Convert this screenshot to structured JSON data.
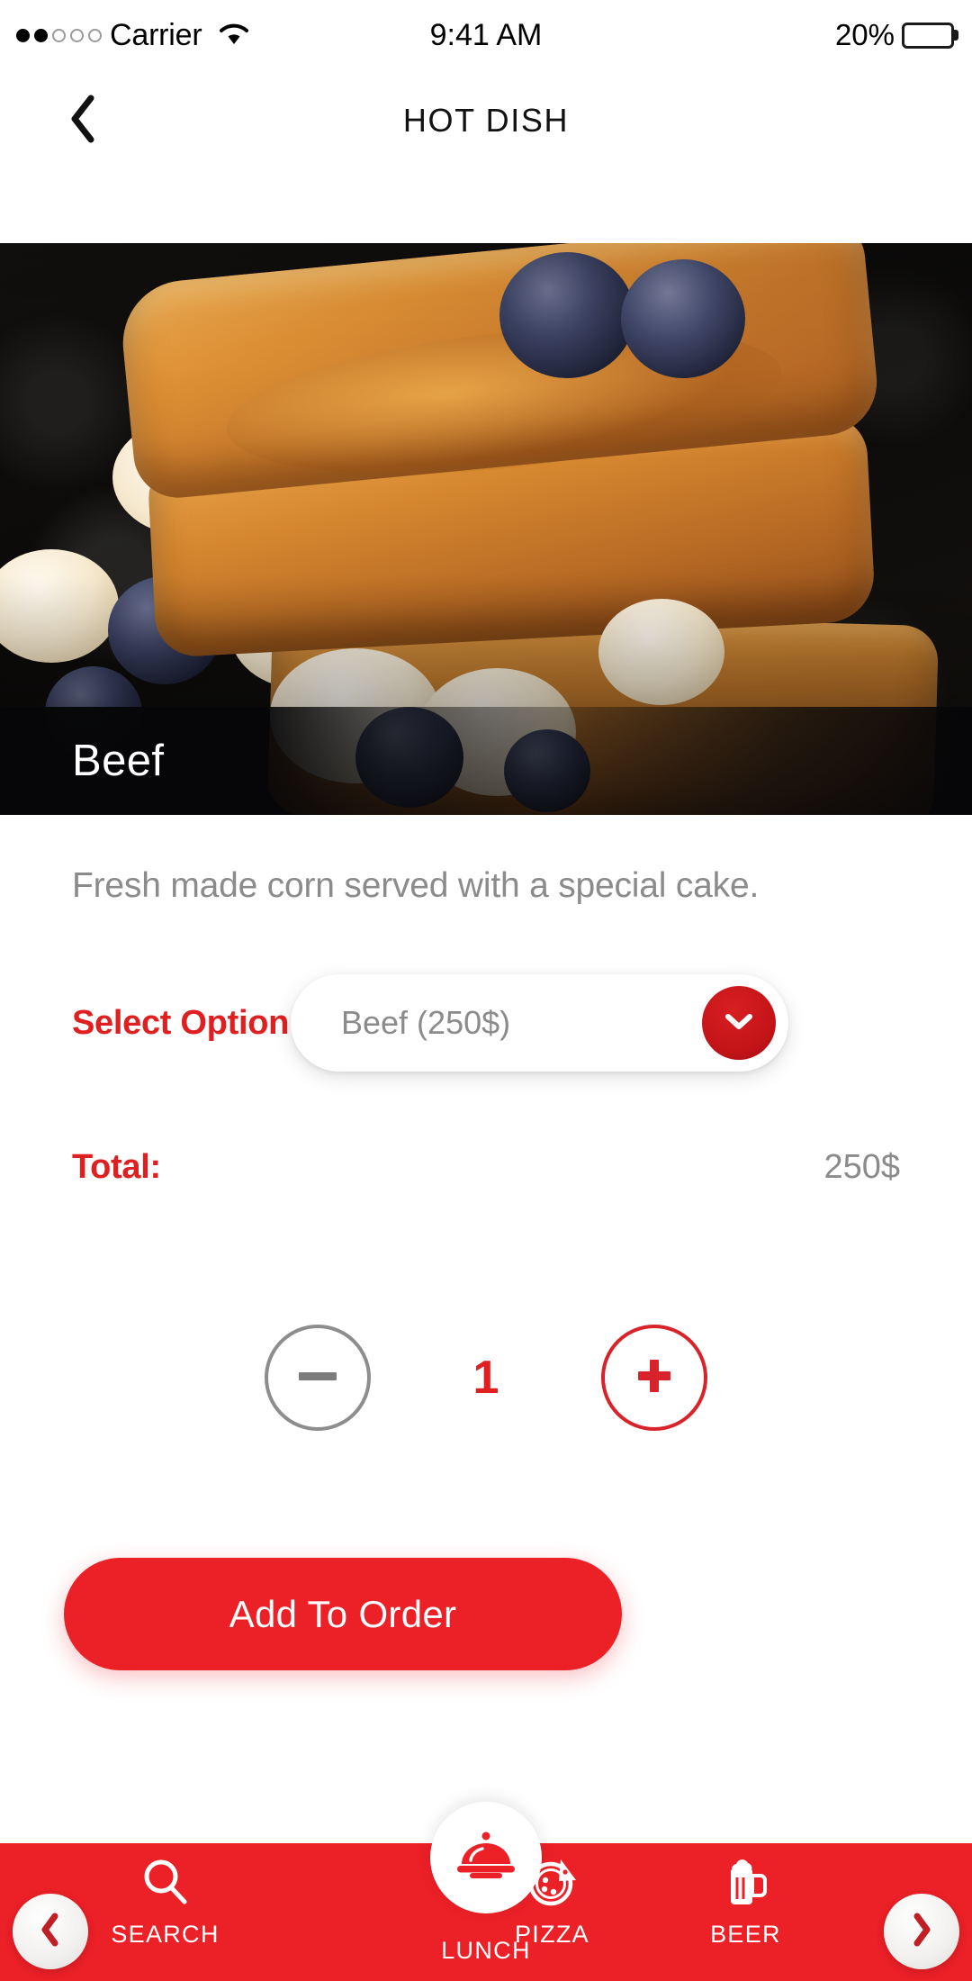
{
  "status_bar": {
    "carrier": "Carrier",
    "signal_dots_filled": 2,
    "signal_dots_total": 5,
    "wifi_icon": "wifi-icon",
    "time": "9:41 AM",
    "battery_percent": "20%",
    "battery_level": 20
  },
  "header": {
    "back_icon": "chevron-left-icon",
    "title": "HOT DISH"
  },
  "hero": {
    "dish_name": "Beef",
    "image_alt": "french-toast-with-bananas-and-blueberries"
  },
  "details": {
    "description": "Fresh made corn served with a special cake.",
    "option_label": "Select Option",
    "option_value": "Beef (250$)",
    "option_caret_icon": "chevron-down-icon",
    "total_label": "Total:",
    "total_value": "250$",
    "quantity": "1",
    "minus_icon": "minus-icon",
    "plus_icon": "plus-icon",
    "add_button_label": "Add To Order"
  },
  "tabbar": {
    "prev_icon": "chevron-left-icon",
    "next_icon": "chevron-right-icon",
    "items": [
      {
        "label": "SEARCH",
        "icon": "search-icon"
      },
      {
        "label": "LUNCH",
        "icon": "cloche-icon"
      },
      {
        "label": "PIZZA",
        "icon": "pizza-icon"
      },
      {
        "label": "BEER",
        "icon": "beer-mug-icon"
      }
    ]
  },
  "colors": {
    "brand_red": "#ec2027",
    "accent_red": "#e02020",
    "dropdown_red": "#c41418",
    "muted_grey": "#8b8b8b",
    "outline_grey": "#8d8d8d"
  }
}
